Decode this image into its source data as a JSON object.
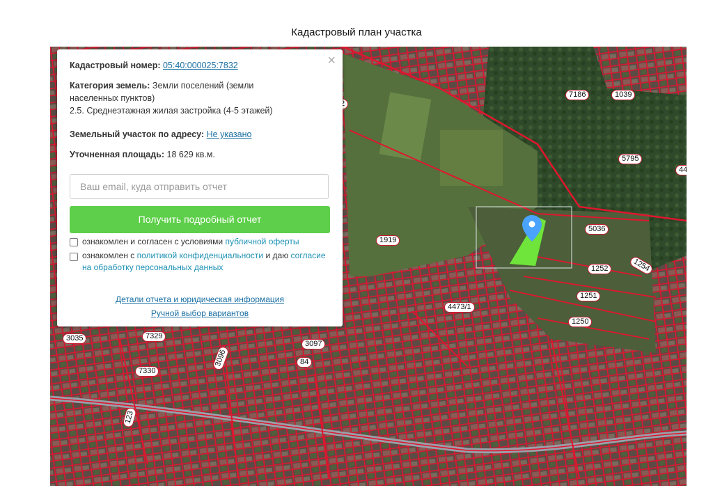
{
  "page_title": "Кадастровый план участка",
  "map": {
    "parcel_labels": [
      "2",
      "7186",
      "1039",
      "5795",
      "44",
      "5036",
      "1919",
      "1252",
      "1254",
      "1251",
      "4473/1",
      "1250",
      "3035",
      "7329",
      "3097",
      "3096",
      "84",
      "7330",
      "123"
    ],
    "colors": {
      "boundary": "#d8102e",
      "selected_parcel": "#6fe43a",
      "marker": "#4aa3ff"
    }
  },
  "panel": {
    "close_icon": "×",
    "cadastral_label": "Кадастровый номер:",
    "cadastral_number": "05:40:000025:7832",
    "category_label": "Категория земель:",
    "category_value_1": "Земли поселений (земли",
    "category_value_2": "населенных пунктов)",
    "usage": "2.5. Среднеэтажная жилая застройка (4-5 этажей)",
    "address_label": "Земельный участок по адресу:",
    "address_value": "Не указано",
    "area_label": "Уточненная площадь:",
    "area_value": "18 629 кв.м.",
    "email_placeholder": "Ваш email, куда отправить отчет",
    "button_label": "Получить подробный отчет",
    "consent1_text": "ознакомлен и согласен с условиями",
    "consent1_link": "публичной оферты",
    "consent2_text": "ознакомлен с",
    "consent2_link1": "политикой конфиденциальности",
    "consent2_and": "и даю",
    "consent2_link2": "согласие на обработку персональных данных",
    "details_link": "Детали отчета и юридическая информация",
    "manual_link": "Ручной выбор вариантов"
  }
}
